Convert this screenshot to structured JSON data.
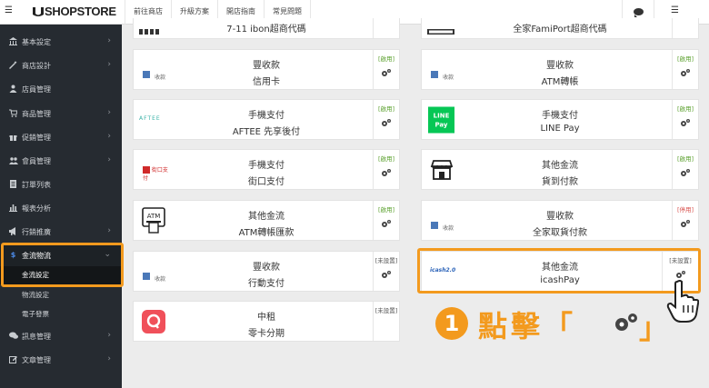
{
  "topbar": {
    "logo": "SHOPSTORE",
    "nav": [
      "前往商店",
      "升級方案",
      "開店指南",
      "常見問題"
    ]
  },
  "sidebar": {
    "items": [
      {
        "label": "基本設定",
        "icon": "bank-icon",
        "glyph": "🏛",
        "chevron": true
      },
      {
        "label": "商店設計",
        "icon": "magic-wand-icon",
        "glyph": "✎",
        "chevron": true
      },
      {
        "label": "店員管理",
        "icon": "user-icon",
        "glyph": "👤",
        "chevron": false
      },
      {
        "label": "商品管理",
        "icon": "cart-icon",
        "glyph": "🛒",
        "chevron": true
      },
      {
        "label": "促銷管理",
        "icon": "gift-icon",
        "glyph": "🎁",
        "chevron": true
      },
      {
        "label": "會員管理",
        "icon": "users-icon",
        "glyph": "👥",
        "chevron": true
      },
      {
        "label": "訂單列表",
        "icon": "document-icon",
        "glyph": "▤",
        "chevron": false
      },
      {
        "label": "報表分析",
        "icon": "bar-chart-icon",
        "glyph": "▮",
        "chevron": false
      },
      {
        "label": "行銷推廣",
        "icon": "megaphone-icon",
        "glyph": "📢",
        "chevron": true
      },
      {
        "label": "金流物流",
        "icon": "dollar-icon",
        "glyph": "$",
        "chevron": true
      },
      {
        "label": "訊息管理",
        "icon": "chat-icon",
        "glyph": "💬",
        "chevron": true
      },
      {
        "label": "文章管理",
        "icon": "edit-icon",
        "glyph": "✎",
        "chevron": true
      }
    ],
    "subitems": [
      "金流設定",
      "物流設定",
      "電子發票"
    ]
  },
  "cards": [
    {
      "title": "",
      "subtitle": "7-11 ibon超商代碼",
      "logo": "ibon-logo",
      "status": ""
    },
    {
      "title": "",
      "subtitle": "全家FamiPort超商代碼",
      "logo": "famiport-logo",
      "status": ""
    },
    {
      "title": "豐收款",
      "subtitle": "信用卡",
      "logo": "收款",
      "status": "[啟用]"
    },
    {
      "title": "豐收款",
      "subtitle": "ATM轉帳",
      "logo": "收款",
      "status": "[啟用]"
    },
    {
      "title": "手機支付",
      "subtitle": "AFTEE 先享後付",
      "logo": "AFTEE",
      "status": "[啟用]"
    },
    {
      "title": "手機支付",
      "subtitle": "LINE Pay",
      "logo": "LINE Pay",
      "status": "[啟用]"
    },
    {
      "title": "手機支付",
      "subtitle": "街口支付",
      "logo": "街口支付",
      "status": "[啟用]"
    },
    {
      "title": "其他金流",
      "subtitle": "貨到付款",
      "logo": "store-logo",
      "status": "[啟用]"
    },
    {
      "title": "其他金流",
      "subtitle": "ATM轉帳匯款",
      "logo": "ATM",
      "status": "[啟用]"
    },
    {
      "title": "豐收款",
      "subtitle": "全家取貨付款",
      "logo": "收款",
      "status": "[停用]"
    },
    {
      "title": "豐收款",
      "subtitle": "行動支付",
      "logo": "收款",
      "status": "[未設置]"
    },
    {
      "title": "其他金流",
      "subtitle": "icashPay",
      "logo": "icash2.0",
      "status": "[未設置]"
    },
    {
      "title": "中租",
      "subtitle": "零卡分期",
      "logo": "zingala-logo",
      "status": "[未設置]"
    }
  ],
  "annotation": {
    "step": "1",
    "text": "點擊「",
    "close": "」"
  },
  "colors": {
    "accent": "#f39a1e",
    "sidebar_bg": "#262b31",
    "enabled": "#5aa02c",
    "disabled": "#d9534f",
    "line_green": "#06c755"
  }
}
